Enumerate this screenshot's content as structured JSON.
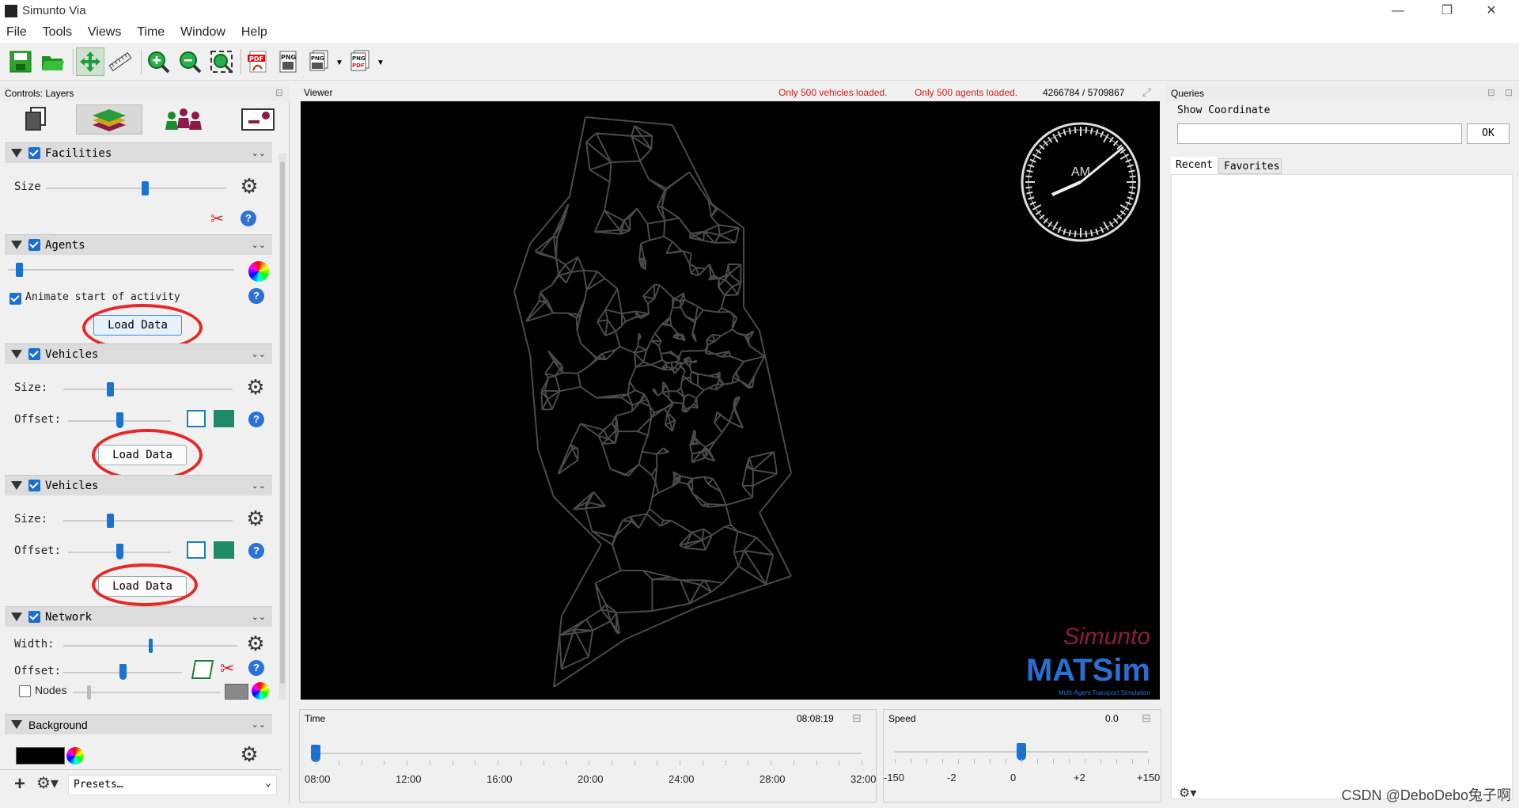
{
  "app": {
    "title": "Simunto Via"
  },
  "window_controls": {
    "minimize": "—",
    "restore": "❐",
    "close": "✕"
  },
  "menu": [
    "File",
    "Tools",
    "Views",
    "Time",
    "Window",
    "Help"
  ],
  "toolbar": {
    "icons": [
      "save-icon",
      "open-folder-icon",
      "pan-icon",
      "ruler-icon",
      "zoom-in-icon",
      "zoom-out-icon",
      "zoom-fit-icon",
      "export-pdf-icon",
      "export-png-icon",
      "export-png-sequence-icon",
      "export-pdf-sequence-icon"
    ],
    "pdf_label": "PDF",
    "png_label": "PNG"
  },
  "controls": {
    "title": "Controls: Layers",
    "tabs": [
      "data-icon",
      "layers-icon",
      "agents-icon",
      "settings-icon"
    ],
    "facilities": {
      "label": "Facilities",
      "size_label": "Size",
      "size_value": 0.55
    },
    "agents": {
      "label": "Agents",
      "slider_value": 0.05,
      "animate_label": "Animate start of activity",
      "load_label": "Load Data"
    },
    "vehicles1": {
      "label": "Vehicles",
      "size_label": "Size:",
      "size_value": 0.28,
      "offset_label": "Offset:",
      "offset_value": 0.5,
      "load_label": "Load Data"
    },
    "vehicles2": {
      "label": "Vehicles",
      "size_label": "Size:",
      "size_value": 0.28,
      "offset_label": "Offset:",
      "offset_value": 0.5,
      "load_label": "Load Data"
    },
    "network": {
      "label": "Network",
      "width_label": "Width:",
      "width_value": 0.5,
      "offset_label": "Offset:",
      "offset_value": 0.5,
      "nodes_label": "Nodes"
    },
    "background": {
      "label": "Background",
      "presets_label": "Presets…"
    }
  },
  "viewer": {
    "title": "Viewer",
    "vehicles_warning": "Only 500 vehicles loaded.",
    "agents_warning": "Only 500 agents loaded.",
    "coords": "4266784 / 5709867",
    "clock_label": "AM",
    "logo_top": "Simunto",
    "logo_main": "MATSim",
    "logo_sub": "Multi-Agent Transport Simulation",
    "warning_color": "#d21e1e"
  },
  "queries": {
    "title": "Queries",
    "show_coord_label": "Show Coordinate",
    "ok_label": "OK",
    "tabs": [
      "Recent",
      "Favorites"
    ]
  },
  "time_panel": {
    "title": "Time",
    "value": "08:08:19",
    "ticks": [
      "08:00",
      "12:00",
      "16:00",
      "20:00",
      "24:00",
      "28:00",
      "32:00"
    ],
    "position": 0.0
  },
  "speed_panel": {
    "title": "Speed",
    "value": "0.0",
    "ticks": [
      "-150",
      "-2",
      "0",
      "+2",
      "+150"
    ],
    "position": 0.5
  },
  "watermark": "CSDN @DeboDebo兔子啊"
}
